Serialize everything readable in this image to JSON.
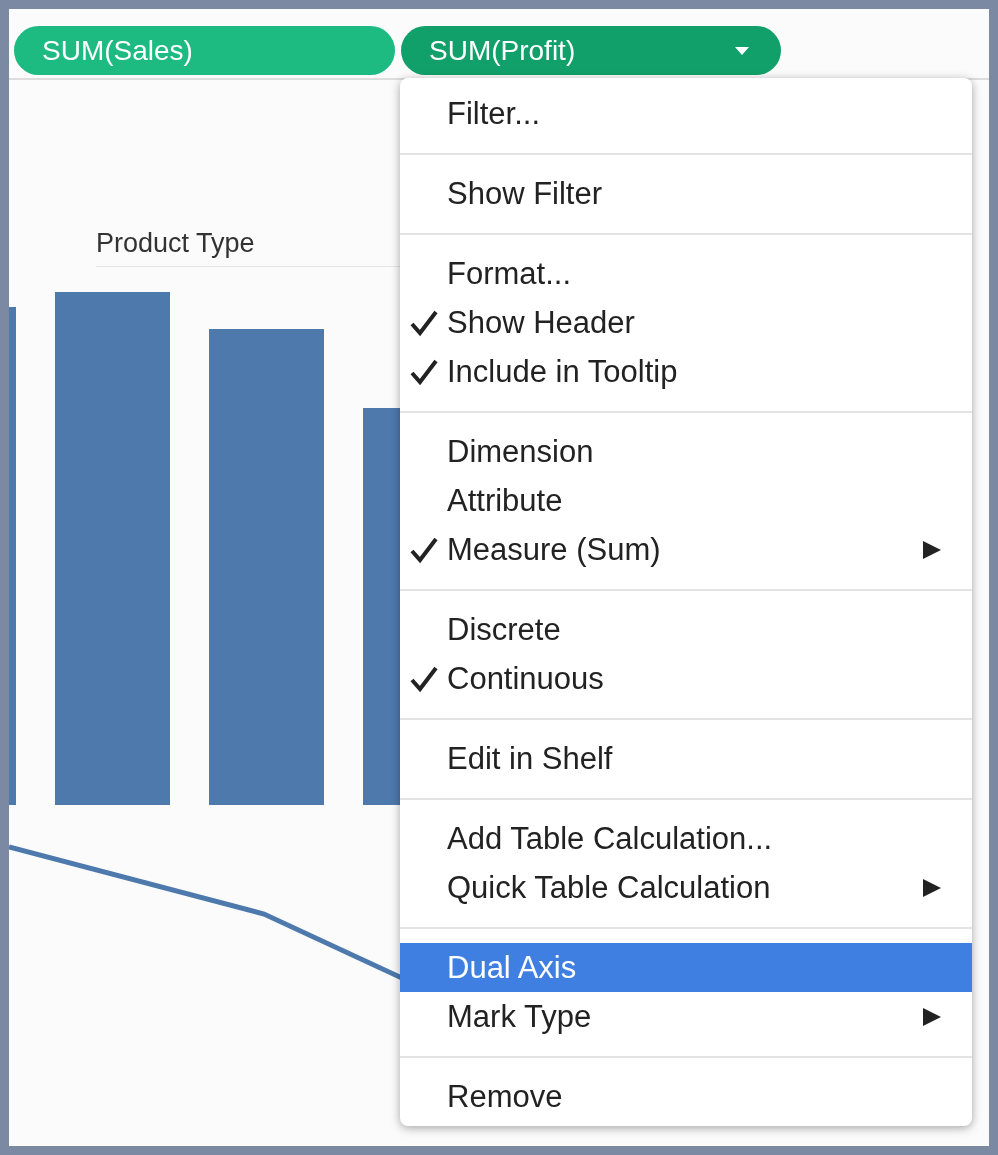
{
  "pills": [
    {
      "label": "SUM(Sales)",
      "dropdown": false
    },
    {
      "label": "SUM(Profit)",
      "dropdown": true
    }
  ],
  "chart": {
    "kind": "picture",
    "header": "Product Type"
  },
  "menu": {
    "sections": [
      [
        {
          "label": "Filter...",
          "checked": false,
          "submenu": false,
          "selected": false
        }
      ],
      [
        {
          "label": "Show Filter",
          "checked": false,
          "submenu": false,
          "selected": false
        }
      ],
      [
        {
          "label": "Format...",
          "checked": false,
          "submenu": false,
          "selected": false
        },
        {
          "label": "Show Header",
          "checked": true,
          "submenu": false,
          "selected": false
        },
        {
          "label": "Include in Tooltip",
          "checked": true,
          "submenu": false,
          "selected": false
        }
      ],
      [
        {
          "label": "Dimension",
          "checked": false,
          "submenu": false,
          "selected": false
        },
        {
          "label": "Attribute",
          "checked": false,
          "submenu": false,
          "selected": false
        },
        {
          "label": "Measure (Sum)",
          "checked": true,
          "submenu": true,
          "selected": false
        }
      ],
      [
        {
          "label": "Discrete",
          "checked": false,
          "submenu": false,
          "selected": false
        },
        {
          "label": "Continuous",
          "checked": true,
          "submenu": false,
          "selected": false
        }
      ],
      [
        {
          "label": "Edit in Shelf",
          "checked": false,
          "submenu": false,
          "selected": false
        }
      ],
      [
        {
          "label": "Add Table Calculation...",
          "checked": false,
          "submenu": false,
          "selected": false
        },
        {
          "label": "Quick Table Calculation",
          "checked": false,
          "submenu": true,
          "selected": false
        }
      ],
      [
        {
          "label": "Dual Axis",
          "checked": false,
          "submenu": false,
          "selected": true
        },
        {
          "label": "Mark Type",
          "checked": false,
          "submenu": true,
          "selected": false
        }
      ],
      [
        {
          "label": "Remove",
          "checked": false,
          "submenu": false,
          "selected": false
        }
      ]
    ]
  }
}
